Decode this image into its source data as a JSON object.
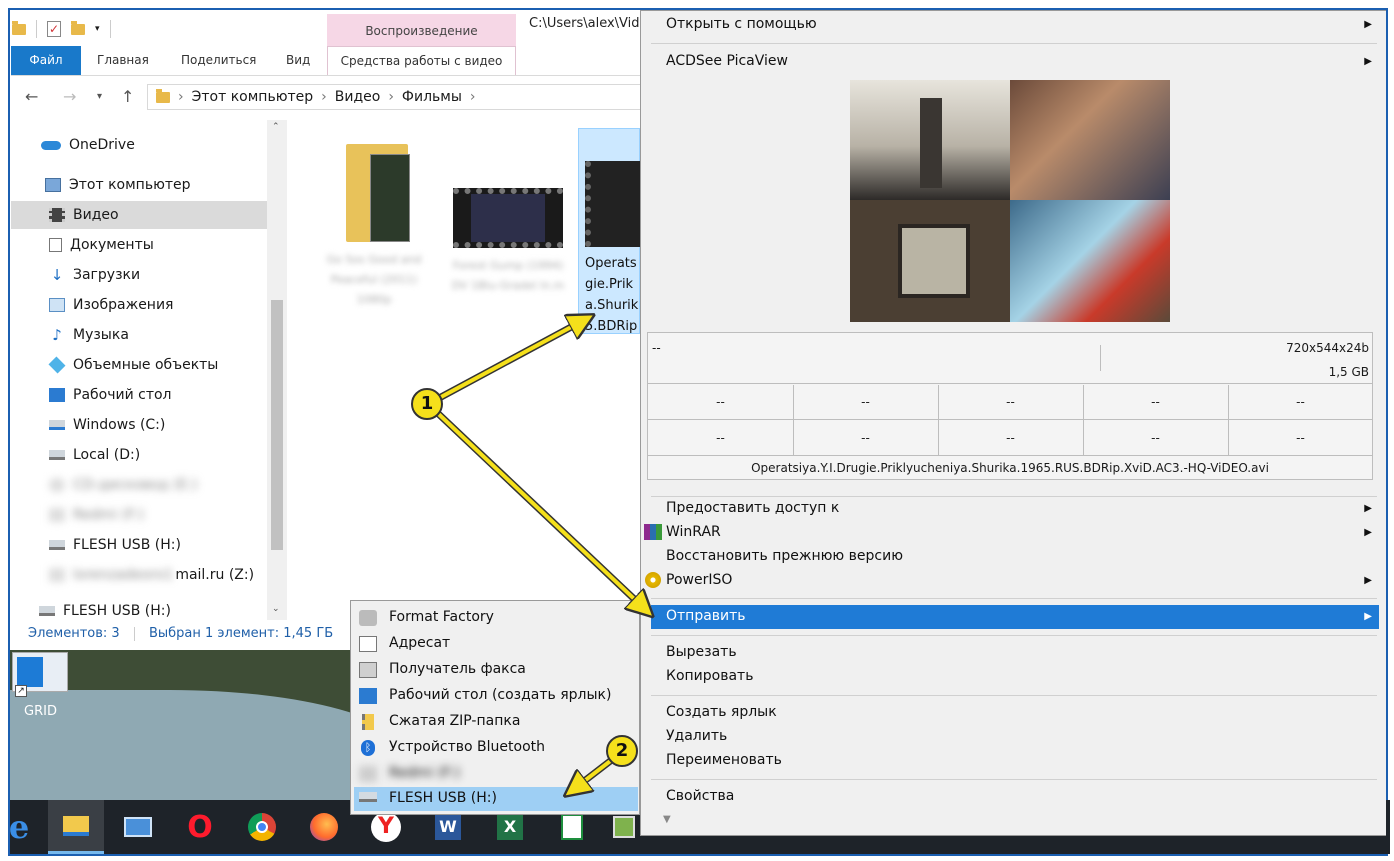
{
  "explorer": {
    "path_title": "C:\\Users\\alex\\Vid",
    "tabs": [
      "Файл",
      "Главная",
      "Поделиться",
      "Вид",
      "Средства работы с видео"
    ],
    "context_tab": "Воспроизведение",
    "breadcrumb": [
      "Этот компьютер",
      "Видео",
      "Фильмы"
    ],
    "sidebar": [
      {
        "label": "OneDrive",
        "icon": "cloud-icon"
      },
      {
        "label": "Этот компьютер",
        "icon": "computer-icon"
      },
      {
        "label": "Видео",
        "icon": "video-icon",
        "selected": true
      },
      {
        "label": "Документы",
        "icon": "document-icon"
      },
      {
        "label": "Загрузки",
        "icon": "download-icon"
      },
      {
        "label": "Изображения",
        "icon": "image-icon"
      },
      {
        "label": "Музыка",
        "icon": "music-icon"
      },
      {
        "label": "Объемные объекты",
        "icon": "cube-icon"
      },
      {
        "label": "Рабочий стол",
        "icon": "desktop-icon"
      },
      {
        "label": "Windows (C:)",
        "icon": "drive-icon"
      },
      {
        "label": "Local (D:)",
        "icon": "drive-icon"
      },
      {
        "label": "CD-дисковод (E:)",
        "icon": "cd-icon",
        "blurred": true
      },
      {
        "label": "Redmi (F:)",
        "icon": "phone-icon",
        "blurred": true
      },
      {
        "label": "FLESH USB (H:)",
        "icon": "usb-icon"
      },
      {
        "label": "mail.ru (Z:)",
        "icon": "network-drive-icon",
        "blurred_prefix": "lorenzadeoro1"
      },
      {
        "label": "FLESH USB (H:)",
        "icon": "usb-icon"
      }
    ],
    "files": [
      {
        "name": "Go Sos Good and Peaceful (2011) 1080p",
        "blurred": true
      },
      {
        "name": "Forest Gump (1994) DV 1Blu-Gradel ln.m",
        "blurred": true
      },
      {
        "name": "Operatsiya.Y.I.Drugie.Priklyucheniya.Shurika.1965.RUS.BDRip",
        "display": "Operats\ngie.Prik\na.Shurik\n5.BDRip"
      }
    ],
    "status": {
      "count": "Элементов: 3",
      "selected": "Выбран 1 элемент: 1,45 ГБ"
    }
  },
  "desktop": {
    "icon_label": "GRID"
  },
  "context_menu": {
    "open_with": "Открыть с помощью",
    "picaview": "ACDSee PicaView",
    "info": {
      "top_left": "--",
      "resolution": "720x544x24b",
      "size": "1,5 GB",
      "rows": [
        [
          "--",
          "--",
          "--",
          "--",
          "--"
        ],
        [
          "--",
          "--",
          "--",
          "--",
          "--"
        ]
      ],
      "filename": "Operatsiya.Y.I.Drugie.Priklyucheniya.Shurika.1965.RUS.BDRip.XviD.AC3.-HQ-ViDEO.avi"
    },
    "items": [
      {
        "label": "Предоставить доступ к",
        "submenu": true
      },
      {
        "label": "WinRAR",
        "submenu": true,
        "icon": "winrar-icon"
      },
      {
        "label": "Восстановить прежнюю версию"
      },
      {
        "label": "PowerISO",
        "submenu": true,
        "icon": "poweriso-icon"
      },
      {
        "label": "Отправить",
        "submenu": true,
        "highlighted": true
      },
      {
        "label": "Вырезать"
      },
      {
        "label": "Копировать"
      },
      {
        "label": "Создать ярлык"
      },
      {
        "label": "Удалить"
      },
      {
        "label": "Переименовать"
      },
      {
        "label": "Свойства"
      }
    ]
  },
  "send_to": {
    "items": [
      {
        "label": "Format Factory",
        "icon": "format-factory-icon"
      },
      {
        "label": "Адресат",
        "icon": "mail-recipient-icon"
      },
      {
        "label": "Получатель факса",
        "icon": "fax-icon"
      },
      {
        "label": "Рабочий стол (создать ярлык)",
        "icon": "desktop-icon"
      },
      {
        "label": "Сжатая ZIP-папка",
        "icon": "zip-folder-icon"
      },
      {
        "label": "Устройство Bluetooth",
        "icon": "bluetooth-icon"
      },
      {
        "label": "Redmi (F:)",
        "icon": "phone-icon",
        "blurred": true
      },
      {
        "label": "FLESH USB (H:)",
        "icon": "usb-icon",
        "highlighted": true
      }
    ]
  },
  "annotations": {
    "badge1": "1",
    "badge2": "2"
  },
  "colors": {
    "accent": "#1f7bd6",
    "badge": "#f5e01b",
    "file_tab": "#1979ca",
    "context_tab": "#f6d7e6"
  },
  "taskbar": [
    "edge-icon",
    "file-explorer-icon",
    "contacts-icon",
    "opera-icon",
    "chrome-icon",
    "firefox-icon",
    "yandex-icon",
    "word-icon",
    "excel-icon",
    "spreadsheet-icon",
    "paint-icon"
  ]
}
